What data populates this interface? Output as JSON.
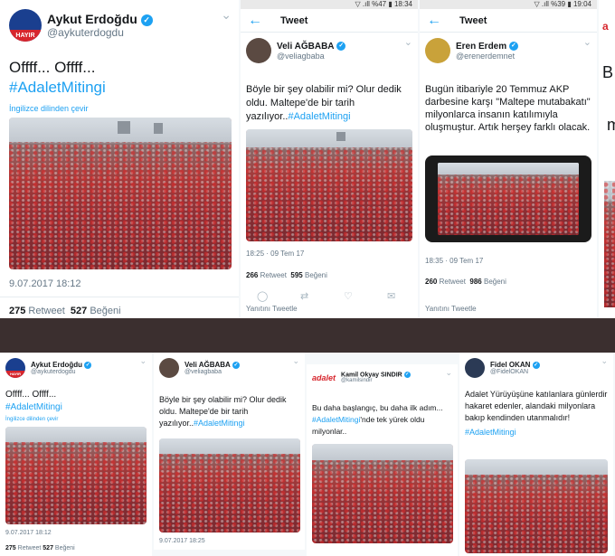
{
  "p1": {
    "name": "Aykut Erdoğdu",
    "handle": "@aykuterdogdu",
    "badge": "HAYIR",
    "text1": "Offff... Offff...",
    "hashtag": "#AdaletMitingi",
    "translate": "İngilizce dilinden çevir",
    "time": "9.07.2017 18:12",
    "rt_n": "275",
    "rt_l": "Retweet",
    "like_n": "527",
    "like_l": "Beğeni"
  },
  "p2": {
    "status": "▽ .ıll %47 ▮ 18:34",
    "back": "←",
    "title": "Tweet",
    "name": "Veli AĞBABA",
    "handle": "@veliagbaba",
    "text": "Böyle bir şey olabilir mi? Olur dedik oldu. Maltepe'de bir tarih yazılıyor..",
    "hashtag": "#AdaletMitingi",
    "time": "18:25 · 09 Tem 17",
    "rt_n": "266",
    "rt_l": "Retweet",
    "like_n": "595",
    "like_l": "Beğeni",
    "reply": "Yanıtını Tweetle"
  },
  "p3": {
    "status": "▽ .ıll %39 ▮ 19:04",
    "back": "←",
    "title": "Tweet",
    "name": "Eren Erdem",
    "handle": "@erenerdemnet",
    "text": "Bugün itibariyle 20 Temmuz AKP darbesine karşı \"Maltepe mutabakatı\" milyonlarca insanın katılımıyla oluşmuştur. Artık herşey farklı olacak.",
    "time": "18:35 · 09 Tem 17",
    "rt_n": "260",
    "rt_l": "Retweet",
    "like_n": "986",
    "like_l": "Beğeni",
    "reply": "Yanıtını Tweetle"
  },
  "p4": {
    "letter1": "B",
    "letter2": "m",
    "brand": "a"
  },
  "q1": {
    "name": "Aykut Erdoğdu",
    "handle": "@aykuterdogdu",
    "badge": "HAYIR",
    "text1": "Offff... Offff...",
    "hashtag": "#AdaletMitingi",
    "translate": "İngilizce dilinden çevir",
    "time": "9.07.2017 18:12",
    "rt_n": "275",
    "rt_l": "Retweet",
    "like_n": "527",
    "like_l": "Beğeni"
  },
  "q2": {
    "name": "Veli AĞBABA",
    "handle": "@veliagbaba",
    "text": "Böyle bir şey olabilir mi? Olur dedik oldu. Maltepe'de bir tarih yazılıyor..",
    "hashtag": "#AdaletMitingi",
    "time": "9.07.2017 18:25"
  },
  "q3": {
    "brand": "adalet",
    "name": "Kamil Okyay SINDIR",
    "handle": "@kamilsindir",
    "text1": "Bu daha başlangıç, bu daha ilk adım...",
    "hashtag": "#AdaletMitingi",
    "text2": "'nde tek yürek oldu milyonlar.."
  },
  "q4": {
    "name": "Fidel OKAN",
    "handle": "@FidelOKAN",
    "text": "Adalet Yürüyüşüne katılanlara günlerdir hakaret edenler, alandaki milyonlara bakıp kendinden utanmalıdır!",
    "hashtag": "#AdaletMitingi"
  },
  "icons": {
    "verified": "✓",
    "chevron": "⌄",
    "reply": "◯",
    "retweet": "⇄",
    "like": "♡",
    "share": "✉"
  }
}
